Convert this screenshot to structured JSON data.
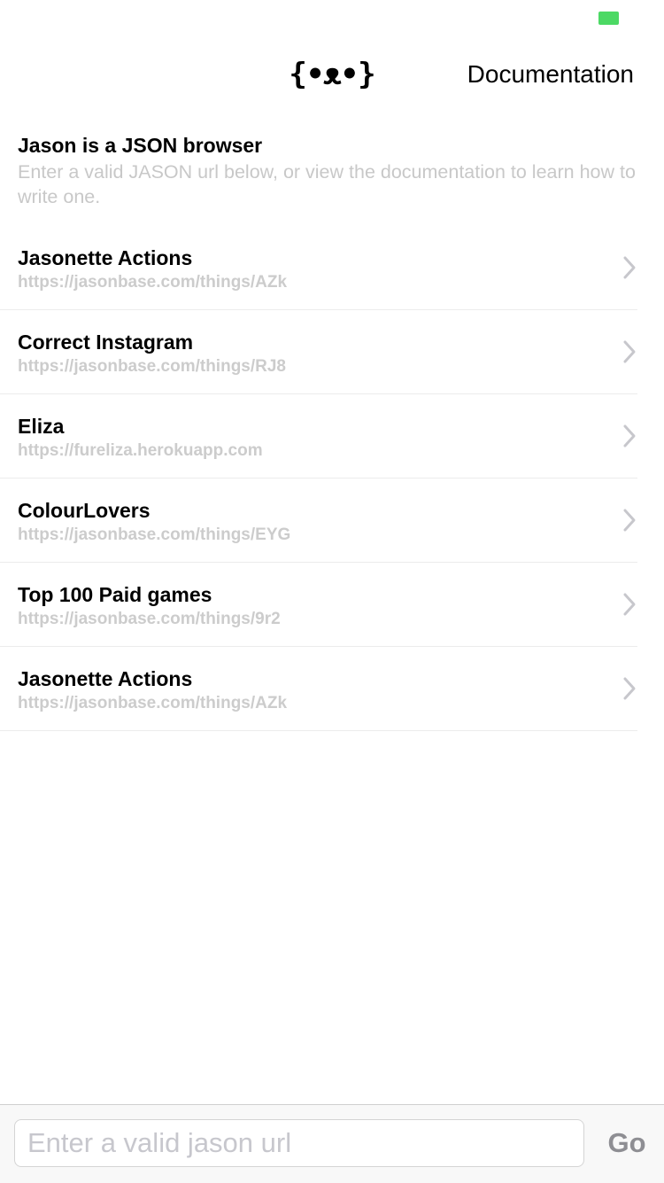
{
  "status_bar": {
    "battery_color": "#4cd964"
  },
  "nav": {
    "logo": "{•ᴥ•}",
    "documentation_label": "Documentation"
  },
  "intro": {
    "title": "Jason is a JSON browser",
    "description": "Enter a valid JASON url below, or view the documentation to learn how to write one."
  },
  "items": [
    {
      "title": "Jasonette Actions",
      "url": "https://jasonbase.com/things/AZk"
    },
    {
      "title": "Correct Instagram",
      "url": "https://jasonbase.com/things/RJ8"
    },
    {
      "title": "Eliza",
      "url": "https://fureliza.herokuapp.com"
    },
    {
      "title": "ColourLovers",
      "url": "https://jasonbase.com/things/EYG"
    },
    {
      "title": "Top 100 Paid games",
      "url": "https://jasonbase.com/things/9r2"
    },
    {
      "title": "Jasonette Actions",
      "url": "https://jasonbase.com/things/AZk"
    }
  ],
  "bottom": {
    "input_placeholder": "Enter a valid jason url",
    "input_value": "",
    "go_label": "Go"
  },
  "icons": {
    "row_chevron": "chevron-right-icon"
  }
}
